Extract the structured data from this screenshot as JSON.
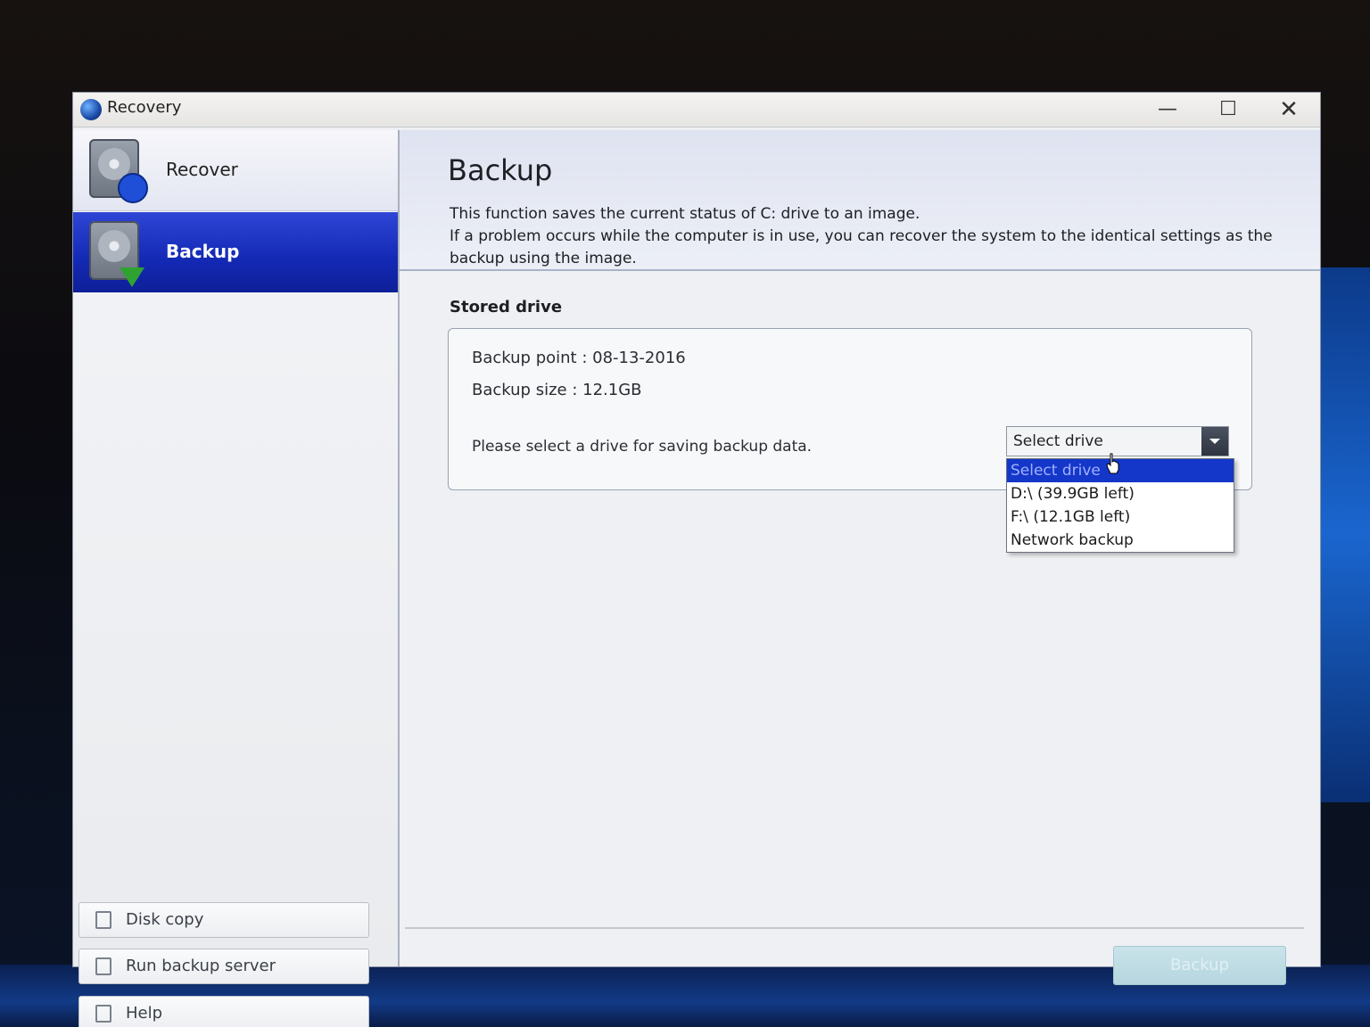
{
  "window": {
    "title": "Recovery",
    "controls": {
      "minimize": "—",
      "maximize": "☐",
      "close": "✕"
    }
  },
  "sidebar": {
    "items": [
      {
        "label": "Recover",
        "icon": "disk-restore-icon",
        "selected": false
      },
      {
        "label": "Backup",
        "icon": "disk-backup-icon",
        "selected": true
      }
    ],
    "buttons": [
      {
        "label": "Disk copy",
        "icon": "copy-icon"
      },
      {
        "label": "Run backup server",
        "icon": "server-icon"
      },
      {
        "label": "Help",
        "icon": "help-icon"
      }
    ]
  },
  "main": {
    "title": "Backup",
    "desc_line1": "This function saves the current status of C: drive to an image.",
    "desc_line2": "If a problem occurs while the computer is in use, you can recover the system to the identical settings as the backup using the image.",
    "stored_drive": {
      "title": "Stored drive",
      "backup_point": "Backup point : 08-13-2016",
      "backup_size": "Backup size : 12.1GB",
      "prompt": "Please select a drive for saving backup data.",
      "select_value": "Select drive",
      "options": [
        "Select drive",
        "D:\\ (39.9GB left)",
        "F:\\ (12.1GB left)",
        "Network backup"
      ]
    },
    "backup_button": "Backup"
  },
  "colors": {
    "accent": "#1329b4",
    "dropdown_highlight": "#1437c9",
    "button_disabled": "#b6d6df"
  }
}
